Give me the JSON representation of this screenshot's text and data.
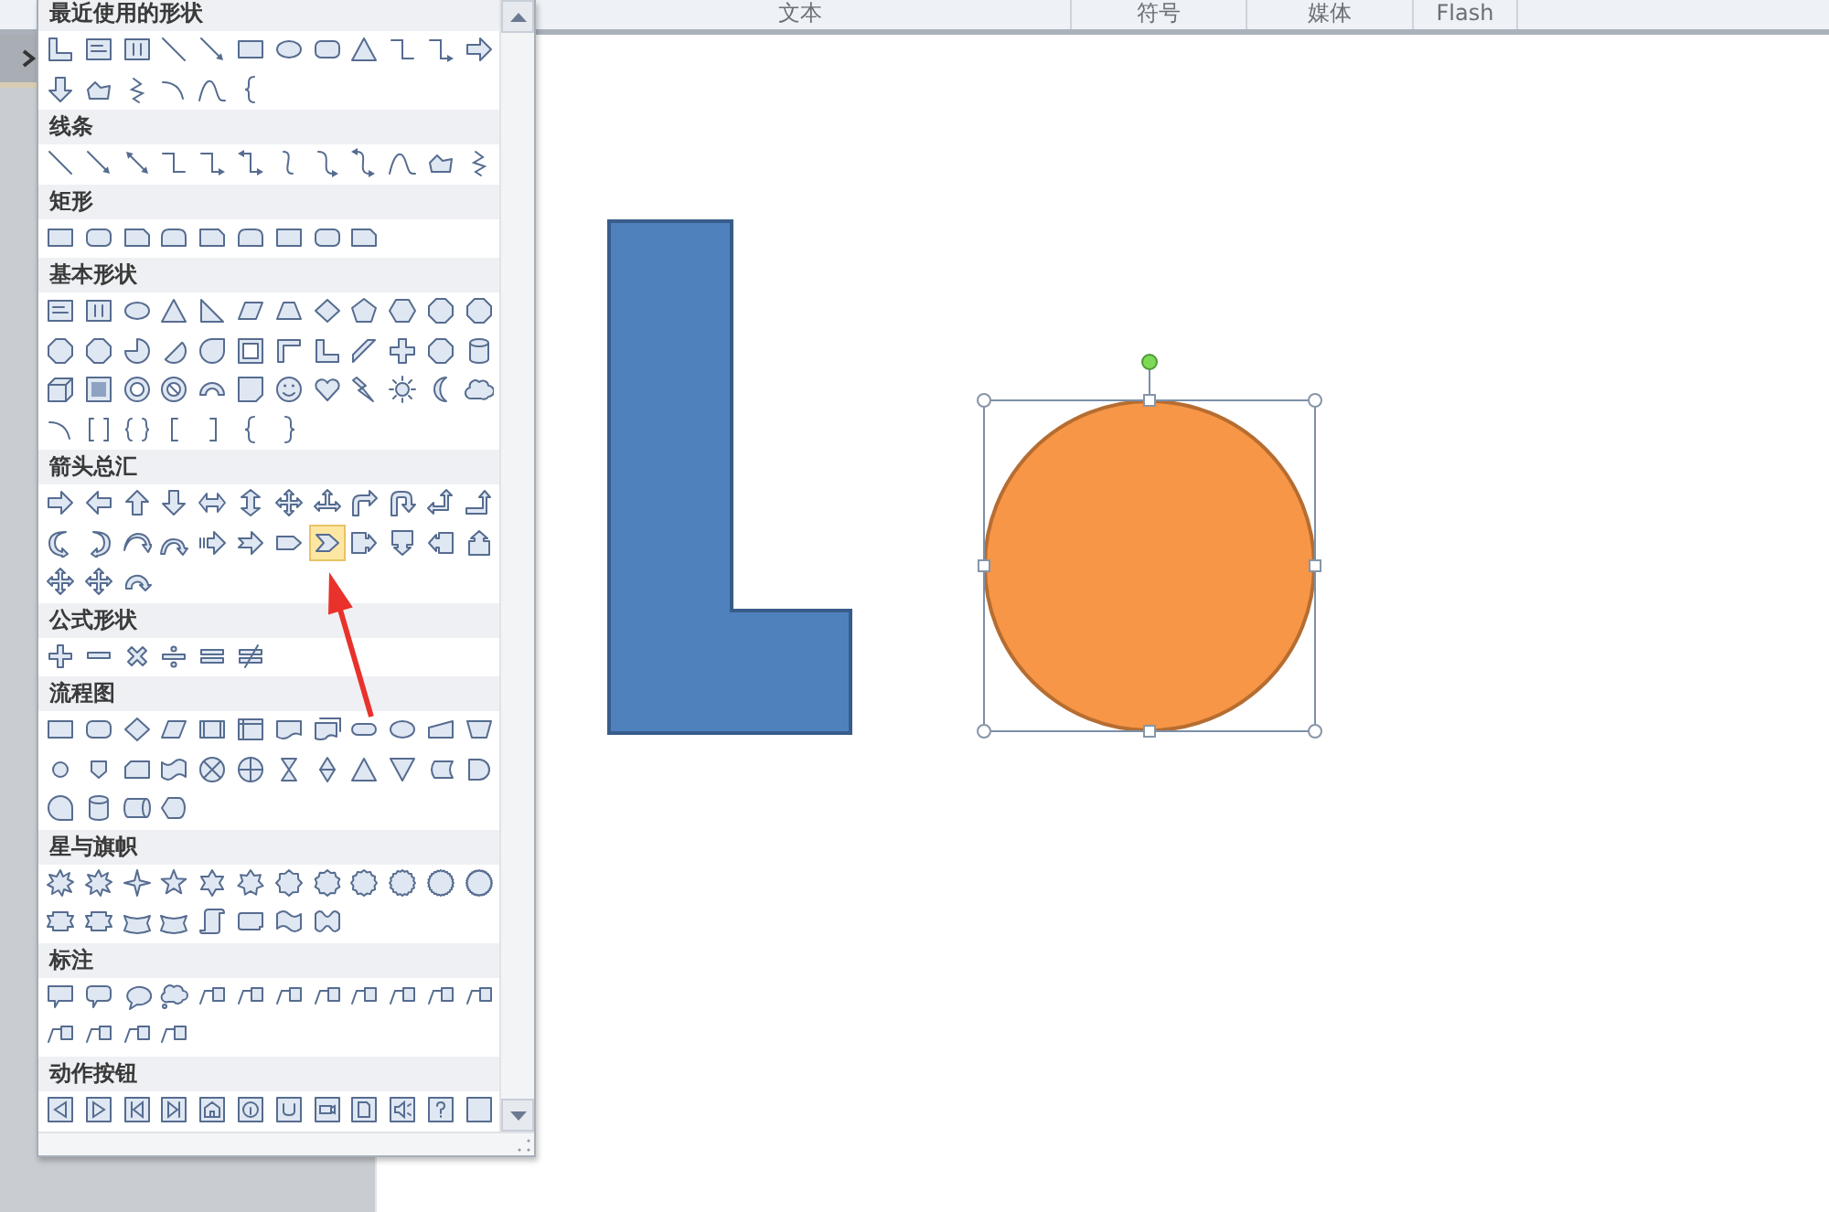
{
  "ribbon": {
    "groups": [
      "文本",
      "符号",
      "媒体",
      "Flash"
    ]
  },
  "sections": [
    {
      "title": "最近使用的形状",
      "shapes": [
        {
          "kind": "l-shape",
          "selected": false
        },
        {
          "kind": "textbox",
          "selected": false
        },
        {
          "kind": "vtextbox",
          "selected": false
        },
        {
          "kind": "line",
          "selected": false
        },
        {
          "kind": "arrow-line",
          "selected": false
        },
        {
          "kind": "rect",
          "selected": false
        },
        {
          "kind": "oval",
          "selected": false
        },
        {
          "kind": "roundrect",
          "selected": false
        },
        {
          "kind": "triangle",
          "selected": false
        },
        {
          "kind": "elbow",
          "selected": false
        },
        {
          "kind": "elbow-arrow",
          "selected": false
        },
        {
          "kind": "right-arrow",
          "selected": false
        },
        {
          "kind": "down-arrow",
          "selected": false
        },
        {
          "kind": "freeform",
          "selected": false
        },
        {
          "kind": "scribble",
          "selected": false
        },
        {
          "kind": "arc",
          "selected": false
        },
        {
          "kind": "curve",
          "selected": false
        },
        {
          "kind": "brace-left",
          "selected": false
        }
      ]
    },
    {
      "title": "线条",
      "shapes": [
        {
          "kind": "line",
          "selected": false
        },
        {
          "kind": "arrow-line",
          "selected": false
        },
        {
          "kind": "double-arrow-line",
          "selected": false
        },
        {
          "kind": "elbow",
          "selected": false
        },
        {
          "kind": "elbow-arrow",
          "selected": false
        },
        {
          "kind": "elbow-double",
          "selected": false
        },
        {
          "kind": "curve-conn",
          "selected": false
        },
        {
          "kind": "curve-arrow",
          "selected": false
        },
        {
          "kind": "curve-double",
          "selected": false
        },
        {
          "kind": "curve",
          "selected": false
        },
        {
          "kind": "freeform",
          "selected": false
        },
        {
          "kind": "scribble",
          "selected": false
        }
      ]
    },
    {
      "title": "矩形",
      "shapes": [
        {
          "kind": "rect",
          "selected": false
        },
        {
          "kind": "roundrect",
          "selected": false
        },
        {
          "kind": "snip-rect",
          "selected": false
        },
        {
          "kind": "round-top",
          "selected": false
        },
        {
          "kind": "snip-rect",
          "selected": false
        },
        {
          "kind": "round-top",
          "selected": false
        },
        {
          "kind": "rect",
          "selected": false
        },
        {
          "kind": "roundrect",
          "selected": false
        },
        {
          "kind": "snip-rect",
          "selected": false
        }
      ]
    },
    {
      "title": "基本形状",
      "shapes": [
        {
          "kind": "textbox",
          "selected": false
        },
        {
          "kind": "vtextbox",
          "selected": false
        },
        {
          "kind": "oval",
          "selected": false
        },
        {
          "kind": "triangle",
          "selected": false
        },
        {
          "kind": "right-triangle",
          "selected": false
        },
        {
          "kind": "parallelogram",
          "selected": false
        },
        {
          "kind": "trapezoid",
          "selected": false
        },
        {
          "kind": "diamond",
          "selected": false
        },
        {
          "kind": "pentagon",
          "selected": false
        },
        {
          "kind": "hexagon",
          "selected": false
        },
        {
          "kind": "octagon",
          "selected": false
        },
        {
          "kind": "octagon",
          "selected": false
        },
        {
          "kind": "octagon",
          "selected": false
        },
        {
          "kind": "octagon",
          "selected": false
        },
        {
          "kind": "pie",
          "selected": false
        },
        {
          "kind": "chord",
          "selected": false
        },
        {
          "kind": "teardrop",
          "selected": false
        },
        {
          "kind": "frame",
          "selected": false
        },
        {
          "kind": "half-frame",
          "selected": false
        },
        {
          "kind": "l-shape",
          "selected": false
        },
        {
          "kind": "diagonal-stripe",
          "selected": false
        },
        {
          "kind": "cross",
          "selected": false
        },
        {
          "kind": "octagon",
          "selected": false
        },
        {
          "kind": "cylinder",
          "selected": false
        },
        {
          "kind": "cube",
          "selected": false
        },
        {
          "kind": "bevel",
          "selected": false
        },
        {
          "kind": "donut",
          "selected": false
        },
        {
          "kind": "no-symbol",
          "selected": false
        },
        {
          "kind": "block-arc",
          "selected": false
        },
        {
          "kind": "folded-corner",
          "selected": false
        },
        {
          "kind": "smiley",
          "selected": false
        },
        {
          "kind": "heart",
          "selected": false
        },
        {
          "kind": "lightning",
          "selected": false
        },
        {
          "kind": "sun",
          "selected": false
        },
        {
          "kind": "moon",
          "selected": false
        },
        {
          "kind": "cloud",
          "selected": false
        },
        {
          "kind": "arc",
          "selected": false
        },
        {
          "kind": "bracket-pair",
          "selected": false
        },
        {
          "kind": "brace-pair",
          "selected": false
        },
        {
          "kind": "bracket-left",
          "selected": false
        },
        {
          "kind": "bracket-right",
          "selected": false
        },
        {
          "kind": "brace-left",
          "selected": false
        },
        {
          "kind": "brace-right",
          "selected": false
        }
      ]
    },
    {
      "title": "箭头总汇",
      "shapes": [
        {
          "kind": "right-arrow",
          "selected": false
        },
        {
          "kind": "left-arrow",
          "selected": false
        },
        {
          "kind": "up-arrow",
          "selected": false
        },
        {
          "kind": "down-arrow",
          "selected": false
        },
        {
          "kind": "left-right-arrow",
          "selected": false
        },
        {
          "kind": "up-down-arrow",
          "selected": false
        },
        {
          "kind": "quad-arrow",
          "selected": false
        },
        {
          "kind": "tri-arrow",
          "selected": false
        },
        {
          "kind": "bent-arrow",
          "selected": false
        },
        {
          "kind": "u-turn-arrow",
          "selected": false
        },
        {
          "kind": "left-up-arrow",
          "selected": false
        },
        {
          "kind": "bent-up-arrow",
          "selected": false
        },
        {
          "kind": "curved-right-arrow",
          "selected": false
        },
        {
          "kind": "curved-left-arrow",
          "selected": false
        },
        {
          "kind": "curved-up-arrow",
          "selected": false
        },
        {
          "kind": "curved-down-arrow",
          "selected": false
        },
        {
          "kind": "striped-arrow",
          "selected": false
        },
        {
          "kind": "notched-arrow",
          "selected": false
        },
        {
          "kind": "pentagon-arrow",
          "selected": false
        },
        {
          "kind": "chevron",
          "selected": true
        },
        {
          "kind": "right-arrow-callout",
          "selected": false
        },
        {
          "kind": "down-arrow-callout",
          "selected": false
        },
        {
          "kind": "left-arrow-callout",
          "selected": false
        },
        {
          "kind": "up-arrow-callout",
          "selected": false
        },
        {
          "kind": "quad-arrow",
          "selected": false
        },
        {
          "kind": "quad-arrow",
          "selected": false
        },
        {
          "kind": "circular-arrow",
          "selected": false
        }
      ]
    },
    {
      "title": "公式形状",
      "shapes": [
        {
          "kind": "plus",
          "selected": false
        },
        {
          "kind": "minus",
          "selected": false
        },
        {
          "kind": "multiply",
          "selected": false
        },
        {
          "kind": "divide",
          "selected": false
        },
        {
          "kind": "equal",
          "selected": false
        },
        {
          "kind": "not-equal",
          "selected": false
        }
      ]
    },
    {
      "title": "流程图",
      "shapes": [
        {
          "kind": "rect",
          "selected": false
        },
        {
          "kind": "roundrect",
          "selected": false
        },
        {
          "kind": "diamond",
          "selected": false
        },
        {
          "kind": "parallelogram",
          "selected": false
        },
        {
          "kind": "predefined",
          "selected": false
        },
        {
          "kind": "internal-storage",
          "selected": false
        },
        {
          "kind": "document",
          "selected": false
        },
        {
          "kind": "multi-document",
          "selected": false
        },
        {
          "kind": "terminator",
          "selected": false
        },
        {
          "kind": "oval",
          "selected": false
        },
        {
          "kind": "manual-input",
          "selected": false
        },
        {
          "kind": "manual-operation",
          "selected": false
        },
        {
          "kind": "connector",
          "selected": false
        },
        {
          "kind": "offpage",
          "selected": false
        },
        {
          "kind": "card",
          "selected": false
        },
        {
          "kind": "punched-tape",
          "selected": false
        },
        {
          "kind": "summing-junction",
          "selected": false
        },
        {
          "kind": "or",
          "selected": false
        },
        {
          "kind": "collate",
          "selected": false
        },
        {
          "kind": "sort",
          "selected": false
        },
        {
          "kind": "triangle",
          "selected": false
        },
        {
          "kind": "merge",
          "selected": false
        },
        {
          "kind": "stored-data",
          "selected": false
        },
        {
          "kind": "delay",
          "selected": false
        },
        {
          "kind": "sequential-access",
          "selected": false
        },
        {
          "kind": "cylinder",
          "selected": false
        },
        {
          "kind": "direct-access",
          "selected": false
        },
        {
          "kind": "display",
          "selected": false
        }
      ]
    },
    {
      "title": "星与旗帜",
      "shapes": [
        {
          "kind": "explosion",
          "selected": false
        },
        {
          "kind": "explosion",
          "selected": false
        },
        {
          "kind": "star4",
          "selected": false
        },
        {
          "kind": "star5",
          "selected": false
        },
        {
          "kind": "star6",
          "selected": false
        },
        {
          "kind": "star7",
          "selected": false
        },
        {
          "kind": "star8",
          "selected": false
        },
        {
          "kind": "star10",
          "selected": false
        },
        {
          "kind": "star12",
          "selected": false
        },
        {
          "kind": "star16",
          "selected": false
        },
        {
          "kind": "star24",
          "selected": false
        },
        {
          "kind": "star32",
          "selected": false
        },
        {
          "kind": "ribbon",
          "selected": false
        },
        {
          "kind": "ribbon",
          "selected": false
        },
        {
          "kind": "curved-ribbon",
          "selected": false
        },
        {
          "kind": "curved-ribbon",
          "selected": false
        },
        {
          "kind": "scroll-v",
          "selected": false
        },
        {
          "kind": "scroll-h",
          "selected": false
        },
        {
          "kind": "wave",
          "selected": false
        },
        {
          "kind": "double-wave",
          "selected": false
        }
      ]
    },
    {
      "title": "标注",
      "shapes": [
        {
          "kind": "rect-callout",
          "selected": false
        },
        {
          "kind": "roundrect-callout",
          "selected": false
        },
        {
          "kind": "oval-callout",
          "selected": false
        },
        {
          "kind": "cloud-callout",
          "selected": false
        },
        {
          "kind": "line-callout",
          "selected": false
        },
        {
          "kind": "line-callout",
          "selected": false
        },
        {
          "kind": "line-callout",
          "selected": false
        },
        {
          "kind": "line-callout",
          "selected": false
        },
        {
          "kind": "line-callout",
          "selected": false
        },
        {
          "kind": "line-callout",
          "selected": false
        },
        {
          "kind": "line-callout",
          "selected": false
        },
        {
          "kind": "line-callout",
          "selected": false
        },
        {
          "kind": "line-callout",
          "selected": false
        },
        {
          "kind": "line-callout",
          "selected": false
        },
        {
          "kind": "line-callout",
          "selected": false
        },
        {
          "kind": "line-callout",
          "selected": false
        }
      ]
    },
    {
      "title": "动作按钮",
      "shapes": [
        {
          "kind": "action-back",
          "selected": false
        },
        {
          "kind": "action-forward",
          "selected": false
        },
        {
          "kind": "action-begin",
          "selected": false
        },
        {
          "kind": "action-end",
          "selected": false
        },
        {
          "kind": "action-home",
          "selected": false
        },
        {
          "kind": "action-info",
          "selected": false
        },
        {
          "kind": "action-return",
          "selected": false
        },
        {
          "kind": "action-movie",
          "selected": false
        },
        {
          "kind": "action-document",
          "selected": false
        },
        {
          "kind": "action-sound",
          "selected": false
        },
        {
          "kind": "action-help",
          "selected": false
        },
        {
          "kind": "action-blank",
          "selected": false
        }
      ]
    }
  ],
  "canvas": {
    "shapes": [
      {
        "kind": "l-shape",
        "selected": false
      },
      {
        "kind": "circle",
        "selected": true
      },
      {
        "kind": "pointer-arrow",
        "selected": false
      }
    ]
  }
}
